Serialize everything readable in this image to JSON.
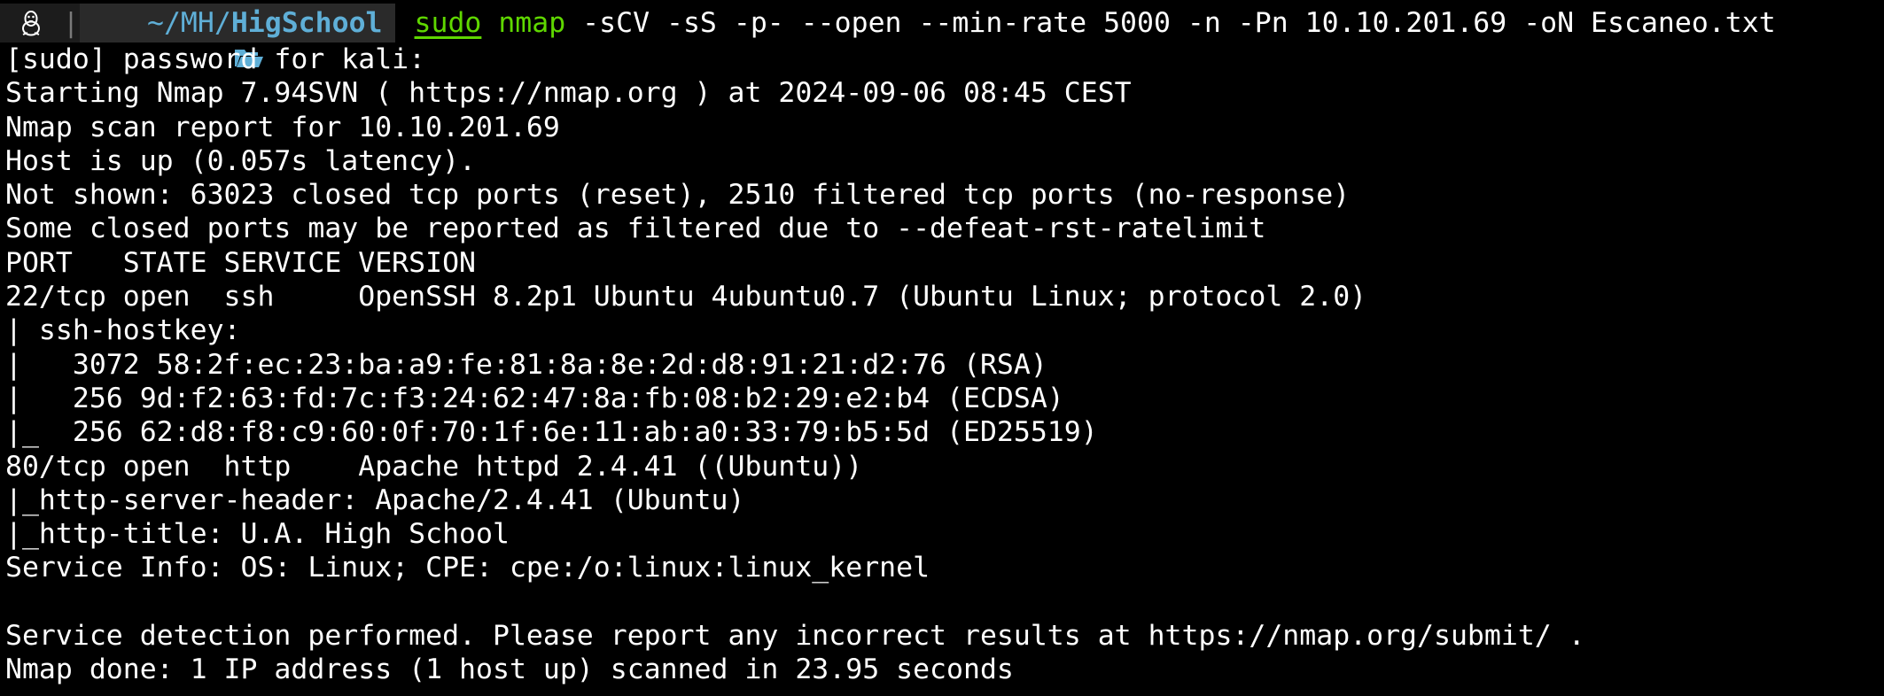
{
  "prompt": {
    "os_icon": "tux-penguin-icon",
    "separator": "|",
    "folder_icon": "folder-open-icon",
    "dir_base": "~/MH/",
    "dir_leaf": "HigSchool",
    "cmd_sudo": "sudo",
    "cmd_tool": "nmap",
    "cmd_args": "-sCV -sS -p- --open --min-rate 5000 -n -Pn 10.10.201.69 -oN Escaneo.txt"
  },
  "output_lines": [
    "[sudo] password for kali:",
    "Starting Nmap 7.94SVN ( https://nmap.org ) at 2024-09-06 08:45 CEST",
    "Nmap scan report for 10.10.201.69",
    "Host is up (0.057s latency).",
    "Not shown: 63023 closed tcp ports (reset), 2510 filtered tcp ports (no-response)",
    "Some closed ports may be reported as filtered due to --defeat-rst-ratelimit",
    "PORT   STATE SERVICE VERSION",
    "22/tcp open  ssh     OpenSSH 8.2p1 Ubuntu 4ubuntu0.7 (Ubuntu Linux; protocol 2.0)",
    "| ssh-hostkey: ",
    "|   3072 58:2f:ec:23:ba:a9:fe:81:8a:8e:2d:d8:91:21:d2:76 (RSA)",
    "|   256 9d:f2:63:fd:7c:f3:24:62:47:8a:fb:08:b2:29:e2:b4 (ECDSA)",
    "|_  256 62:d8:f8:c9:60:0f:70:1f:6e:11:ab:a0:33:79:b5:5d (ED25519)",
    "80/tcp open  http    Apache httpd 2.4.41 ((Ubuntu))",
    "|_http-server-header: Apache/2.4.41 (Ubuntu)",
    "|_http-title: U.A. High School",
    "Service Info: OS: Linux; CPE: cpe:/o:linux:linux_kernel",
    "",
    "Service detection performed. Please report any incorrect results at https://nmap.org/submit/ .",
    "Nmap done: 1 IP address (1 host up) scanned in 23.95 seconds"
  ],
  "colors": {
    "background": "#000000",
    "text": "#ffffff",
    "command_green": "#5fd700",
    "directory_blue": "#5fafd7"
  }
}
